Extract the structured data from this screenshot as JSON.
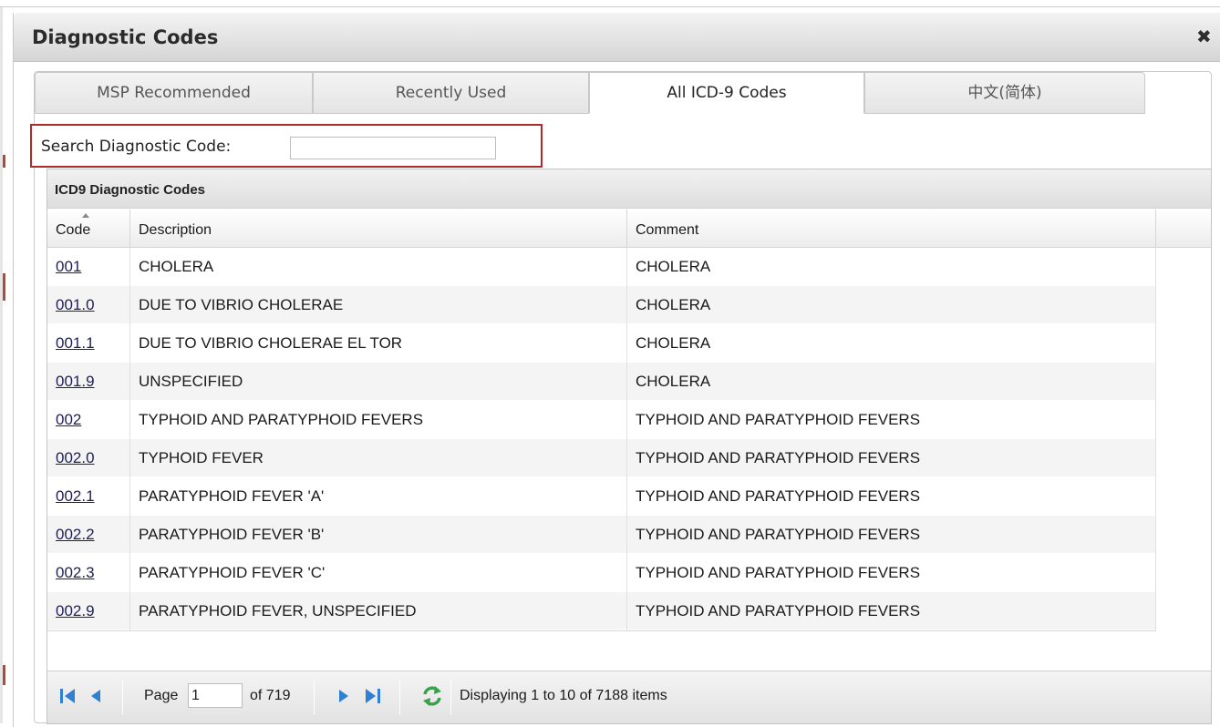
{
  "dialog": {
    "title": "Diagnostic Codes",
    "close_glyph": "✖"
  },
  "tabs": [
    {
      "label": "MSP Recommended",
      "active": false
    },
    {
      "label": "Recently Used",
      "active": false
    },
    {
      "label": "All ICD-9 Codes",
      "active": true
    },
    {
      "label": "中文(简体)",
      "active": false
    }
  ],
  "search": {
    "label": "Search Diagnostic Code:",
    "value": ""
  },
  "grid": {
    "caption": "ICD9 Diagnostic Codes",
    "columns": {
      "code": "Code",
      "description": "Description",
      "comment": "Comment"
    },
    "rows": [
      {
        "code": "001",
        "description": "CHOLERA",
        "comment": "CHOLERA"
      },
      {
        "code": "001.0",
        "description": "DUE TO VIBRIO CHOLERAE",
        "comment": "CHOLERA"
      },
      {
        "code": "001.1",
        "description": "DUE TO VIBRIO CHOLERAE EL TOR",
        "comment": "CHOLERA"
      },
      {
        "code": "001.9",
        "description": "UNSPECIFIED",
        "comment": "CHOLERA"
      },
      {
        "code": "002",
        "description": "TYPHOID AND PARATYPHOID FEVERS",
        "comment": "TYPHOID AND PARATYPHOID FEVERS"
      },
      {
        "code": "002.0",
        "description": "TYPHOID FEVER",
        "comment": "TYPHOID AND PARATYPHOID FEVERS"
      },
      {
        "code": "002.1",
        "description": "PARATYPHOID FEVER 'A'",
        "comment": "TYPHOID AND PARATYPHOID FEVERS"
      },
      {
        "code": "002.2",
        "description": "PARATYPHOID FEVER 'B'",
        "comment": "TYPHOID AND PARATYPHOID FEVERS"
      },
      {
        "code": "002.3",
        "description": "PARATYPHOID FEVER 'C'",
        "comment": "TYPHOID AND PARATYPHOID FEVERS"
      },
      {
        "code": "002.9",
        "description": "PARATYPHOID FEVER, UNSPECIFIED",
        "comment": "TYPHOID AND PARATYPHOID FEVERS"
      }
    ]
  },
  "pager": {
    "page_label": "Page",
    "page_value": "1",
    "of_label": "of 719",
    "status": "Displaying 1 to 10 of 7188 items",
    "icons": [
      "first-page-icon",
      "prev-page-icon",
      "next-page-icon",
      "last-page-icon",
      "refresh-icon"
    ]
  },
  "colors": {
    "search_highlight": "#b02a2a",
    "pager_arrow": "#2f7fd2",
    "refresh": "#3aa04a",
    "code_link": "#1f1f5a"
  }
}
